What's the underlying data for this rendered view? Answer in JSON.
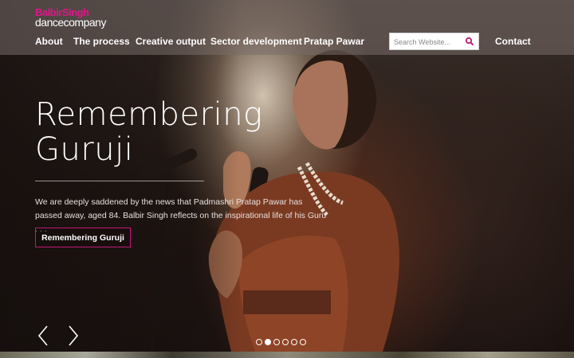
{
  "brand": {
    "line1": "BalbirSingh",
    "line2": "dancecompany",
    "accent_color": "#e0168a"
  },
  "nav": {
    "items": [
      "About",
      "The process",
      "Creative output",
      "Sector development",
      "Pratap Pawar"
    ],
    "contact": "Contact"
  },
  "search": {
    "placeholder": "Search Website...",
    "icon": "search-icon"
  },
  "hero": {
    "title_line1": "Remembering",
    "title_line2": "Guruji",
    "description": "We are deeply saddened by the news that Padmashri Pratap Pawar has passed away, aged 84. Balbir Singh reflects on the inspirational life of his Guru . . .",
    "button_label": "Remembering Guruji"
  },
  "carousel": {
    "slide_count": 6,
    "active_index": 1,
    "prev_icon": "chevron-left-icon",
    "next_icon": "chevron-right-icon"
  }
}
